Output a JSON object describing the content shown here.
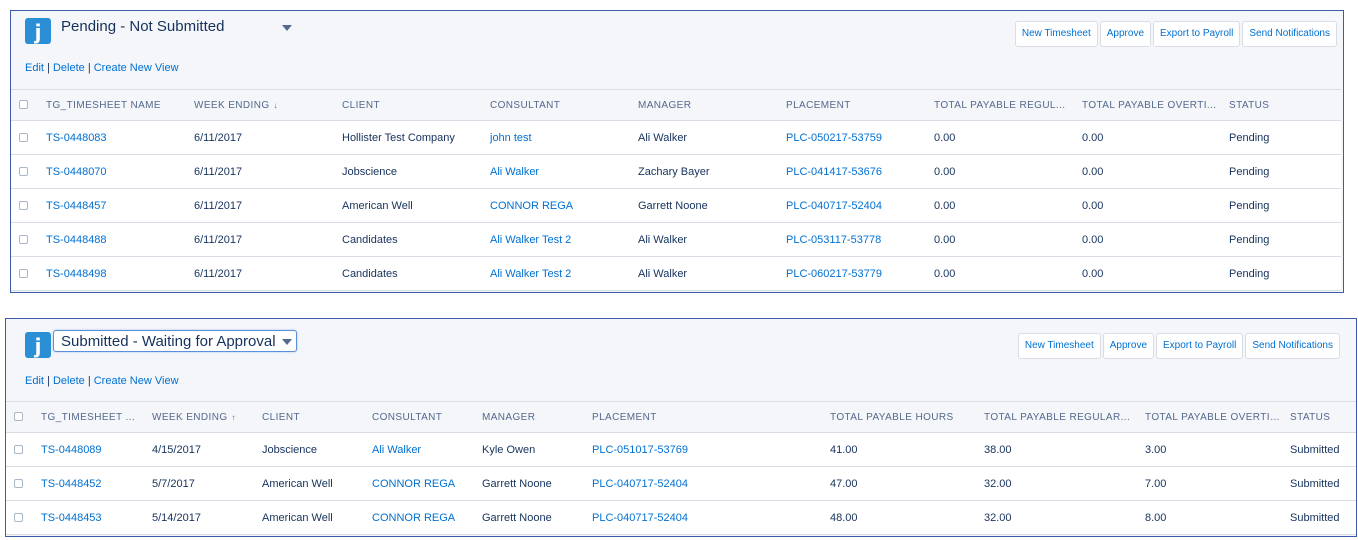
{
  "panels": [
    {
      "view_title": "Pending - Not Submitted",
      "buttons": [
        "New Timesheet",
        "Approve",
        "Export to Payroll",
        "Send Notifications"
      ],
      "links": {
        "edit": "Edit",
        "delete": "Delete",
        "create": "Create New View",
        "sep": "|"
      },
      "sort_icon": "↓",
      "columns": [
        "TG_TIMESHEET NAME",
        "WEEK ENDING",
        "CLIENT",
        "CONSULTANT",
        "MANAGER",
        "PLACEMENT",
        "TOTAL PAYABLE REGUL...",
        "TOTAL PAYABLE OVERTI...",
        "STATUS"
      ],
      "rows": [
        [
          "TS-0448083",
          "6/11/2017",
          "Hollister Test Company",
          "john test",
          "Ali Walker",
          "PLC-050217-53759",
          "0.00",
          "0.00",
          "Pending"
        ],
        [
          "TS-0448070",
          "6/11/2017",
          "Jobscience",
          "Ali Walker",
          "Zachary Bayer",
          "PLC-041417-53676",
          "0.00",
          "0.00",
          "Pending"
        ],
        [
          "TS-0448457",
          "6/11/2017",
          "American Well",
          "CONNOR REGA",
          "Garrett Noone",
          "PLC-040717-52404",
          "0.00",
          "0.00",
          "Pending"
        ],
        [
          "TS-0448488",
          "6/11/2017",
          "Candidates",
          "Ali Walker Test 2",
          "Ali Walker",
          "PLC-053117-53778",
          "0.00",
          "0.00",
          "Pending"
        ],
        [
          "TS-0448498",
          "6/11/2017",
          "Candidates",
          "Ali Walker Test 2",
          "Ali Walker",
          "PLC-060217-53779",
          "0.00",
          "0.00",
          "Pending"
        ]
      ]
    },
    {
      "view_title": "Submitted - Waiting for Approval",
      "buttons": [
        "New Timesheet",
        "Approve",
        "Export to Payroll",
        "Send Notifications"
      ],
      "links": {
        "edit": "Edit",
        "delete": "Delete",
        "create": "Create New View",
        "sep": "|"
      },
      "sort_icon": "↑",
      "columns": [
        "TG_TIMESHEET ...",
        "WEEK ENDING",
        "CLIENT",
        "CONSULTANT",
        "MANAGER",
        "PLACEMENT",
        "TOTAL PAYABLE HOURS",
        "TOTAL PAYABLE REGULAR...",
        "TOTAL PAYABLE OVERTIM...",
        "STATUS"
      ],
      "rows": [
        [
          "TS-0448089",
          "4/15/2017",
          "Jobscience",
          "Ali Walker",
          "Kyle Owen",
          "PLC-051017-53769",
          "41.00",
          "38.00",
          "3.00",
          "Submitted"
        ],
        [
          "TS-0448452",
          "5/7/2017",
          "American Well",
          "CONNOR REGA",
          "Garrett Noone",
          "PLC-040717-52404",
          "47.00",
          "32.00",
          "7.00",
          "Submitted"
        ],
        [
          "TS-0448453",
          "5/14/2017",
          "American Well",
          "CONNOR REGA",
          "Garrett Noone",
          "PLC-040717-52404",
          "48.00",
          "32.00",
          "8.00",
          "Submitted"
        ]
      ]
    }
  ],
  "app_icon_letter": "j",
  "colors": {
    "link": "#0070d2",
    "panel_border": "#3c5ba8",
    "app_icon": "#2b8fd6"
  }
}
